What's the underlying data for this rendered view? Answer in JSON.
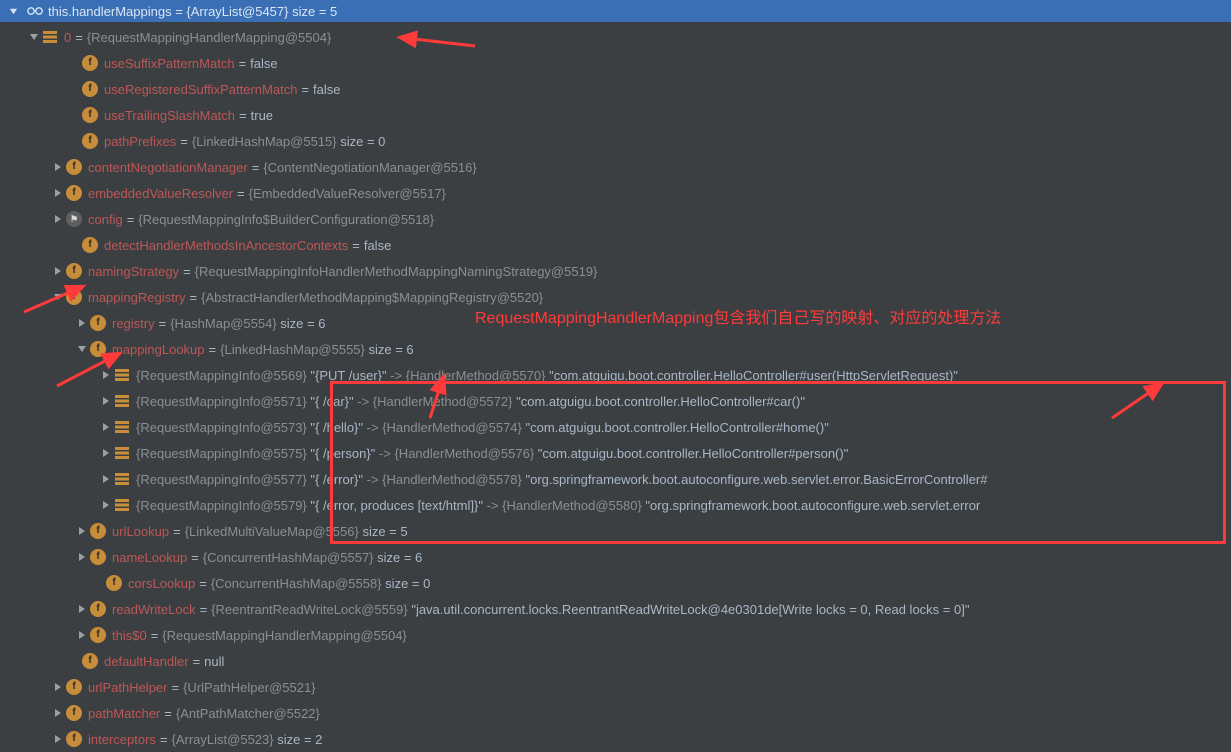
{
  "header": {
    "text": "this.handlerMappings = {ArrayList@5457}  size = 5"
  },
  "rows": [
    {
      "indent": 28,
      "toggle": "down",
      "icon": "list",
      "name_html": "<span class='idx'>0</span>",
      "val": "{RequestMappingHandlerMapping@5504}"
    },
    {
      "indent": 68,
      "toggle": null,
      "icon": "f",
      "name_html": "<span class='field-name'>useSuffixPatternMatch</span>",
      "val_lit": "false"
    },
    {
      "indent": 68,
      "toggle": null,
      "icon": "f",
      "name_html": "<span class='field-name'>useRegisteredSuffixPatternMatch</span>",
      "val_lit": "false"
    },
    {
      "indent": 68,
      "toggle": null,
      "icon": "f",
      "name_html": "<span class='field-name'>useTrailingSlashMatch</span>",
      "val_lit": "true"
    },
    {
      "indent": 68,
      "toggle": null,
      "icon": "f",
      "name_html": "<span class='field-name'>pathPrefixes</span>",
      "val": "{LinkedHashMap@5515}",
      "suffix": "  size = 0"
    },
    {
      "indent": 52,
      "toggle": "right",
      "icon": "f",
      "name_html": "<span class='field-name'>contentNegotiationManager</span>",
      "val": "{ContentNegotiationManager@5516}"
    },
    {
      "indent": 52,
      "toggle": "right",
      "icon": "f",
      "name_html": "<span class='field-name'>embeddedValueResolver</span>",
      "val": "{EmbeddedValueResolver@5517}"
    },
    {
      "indent": 52,
      "toggle": "right",
      "icon": "flags",
      "name_html": "<span class='field-name'>config</span>",
      "val": "{RequestMappingInfo$BuilderConfiguration@5518}"
    },
    {
      "indent": 68,
      "toggle": null,
      "icon": "f",
      "name_html": "<span class='field-name'>detectHandlerMethodsInAncestorContexts</span>",
      "val_lit": "false"
    },
    {
      "indent": 52,
      "toggle": "right",
      "icon": "f",
      "name_html": "<span class='field-name'>namingStrategy</span>",
      "val": "{RequestMappingInfoHandlerMethodMappingNamingStrategy@5519}"
    },
    {
      "indent": 52,
      "toggle": "down",
      "icon": "f",
      "name_html": "<span class='field-name'>mappingRegistry</span>",
      "val": "{AbstractHandlerMethodMapping$MappingRegistry@5520}"
    },
    {
      "indent": 76,
      "toggle": "right",
      "icon": "f",
      "name_html": "<span class='field-name'>registry</span>",
      "val": "{HashMap@5554}",
      "suffix": "  size = 6"
    },
    {
      "indent": 76,
      "toggle": "down",
      "icon": "f",
      "name_html": "<span class='field-name'>mappingLookup</span>",
      "val": "{LinkedHashMap@5555}",
      "suffix": "  size = 6"
    },
    {
      "indent": 100,
      "toggle": "right",
      "icon": "list",
      "name_html": "<span class='valstr'>{RequestMappingInfo@5569}</span>",
      "map_key": "\"{PUT /user}\"",
      "map_mid": "{HandlerMethod@5570}",
      "map_val": "\"com.atguigu.boot.controller.HelloController#user(HttpServletRequest)\""
    },
    {
      "indent": 100,
      "toggle": "right",
      "icon": "list",
      "name_html": "<span class='valstr'>{RequestMappingInfo@5571}</span>",
      "map_key": "\"{ /car}\"",
      "map_mid": "{HandlerMethod@5572}",
      "map_val": "\"com.atguigu.boot.controller.HelloController#car()\""
    },
    {
      "indent": 100,
      "toggle": "right",
      "icon": "list",
      "name_html": "<span class='valstr'>{RequestMappingInfo@5573}</span>",
      "map_key": "\"{ /hello}\"",
      "map_mid": "{HandlerMethod@5574}",
      "map_val": "\"com.atguigu.boot.controller.HelloController#home()\""
    },
    {
      "indent": 100,
      "toggle": "right",
      "icon": "list",
      "name_html": "<span class='valstr'>{RequestMappingInfo@5575}</span>",
      "map_key": "\"{ /person}\"",
      "map_mid": "{HandlerMethod@5576}",
      "map_val": "\"com.atguigu.boot.controller.HelloController#person()\""
    },
    {
      "indent": 100,
      "toggle": "right",
      "icon": "list",
      "name_html": "<span class='valstr'>{RequestMappingInfo@5577}</span>",
      "map_key": "\"{ /error}\"",
      "map_mid": "{HandlerMethod@5578}",
      "map_val": "\"org.springframework.boot.autoconfigure.web.servlet.error.BasicErrorController#"
    },
    {
      "indent": 100,
      "toggle": "right",
      "icon": "list",
      "name_html": "<span class='valstr'>{RequestMappingInfo@5579}</span>",
      "map_key": "\"{ /error, produces [text/html]}\"",
      "map_mid": "{HandlerMethod@5580}",
      "map_val": "\"org.springframework.boot.autoconfigure.web.servlet.error"
    },
    {
      "indent": 76,
      "toggle": "right",
      "icon": "f",
      "name_html": "<span class='field-name'>urlLookup</span>",
      "val": "{LinkedMultiValueMap@5556}",
      "suffix": "  size = 5"
    },
    {
      "indent": 76,
      "toggle": "right",
      "icon": "f",
      "name_html": "<span class='field-name'>nameLookup</span>",
      "val": "{ConcurrentHashMap@5557}",
      "suffix": "  size = 6"
    },
    {
      "indent": 92,
      "toggle": null,
      "icon": "f",
      "name_html": "<span class='field-name'>corsLookup</span>",
      "val": "{ConcurrentHashMap@5558}",
      "suffix": "  size = 0"
    },
    {
      "indent": 76,
      "toggle": "right",
      "icon": "f",
      "name_html": "<span class='field-name'>readWriteLock</span>",
      "val": "{ReentrantReadWriteLock@5559}",
      "quoted": "\"java.util.concurrent.locks.ReentrantReadWriteLock@4e0301de[Write locks = 0, Read locks = 0]\""
    },
    {
      "indent": 76,
      "toggle": "right",
      "icon": "f",
      "name_html": "<span class='field-name'>this$0</span>",
      "val": "{RequestMappingHandlerMapping@5504}"
    },
    {
      "indent": 68,
      "toggle": null,
      "icon": "f",
      "name_html": "<span class='field-name'>defaultHandler</span>",
      "val_lit": "null"
    },
    {
      "indent": 52,
      "toggle": "right",
      "icon": "f",
      "name_html": "<span class='field-name'>urlPathHelper</span>",
      "val": "{UrlPathHelper@5521}"
    },
    {
      "indent": 52,
      "toggle": "right",
      "icon": "f",
      "name_html": "<span class='field-name'>pathMatcher</span>",
      "val": "{AntPathMatcher@5522}"
    },
    {
      "indent": 52,
      "toggle": "right",
      "icon": "f",
      "name_html": "<span class='field-name'>interceptors</span>",
      "val": "{ArrayList@5523}",
      "suffix": "  size = 2"
    }
  ],
  "annotations": {
    "text": "RequestMappingHandlerMapping包含我们自己写的映射、对应的处理方法"
  }
}
